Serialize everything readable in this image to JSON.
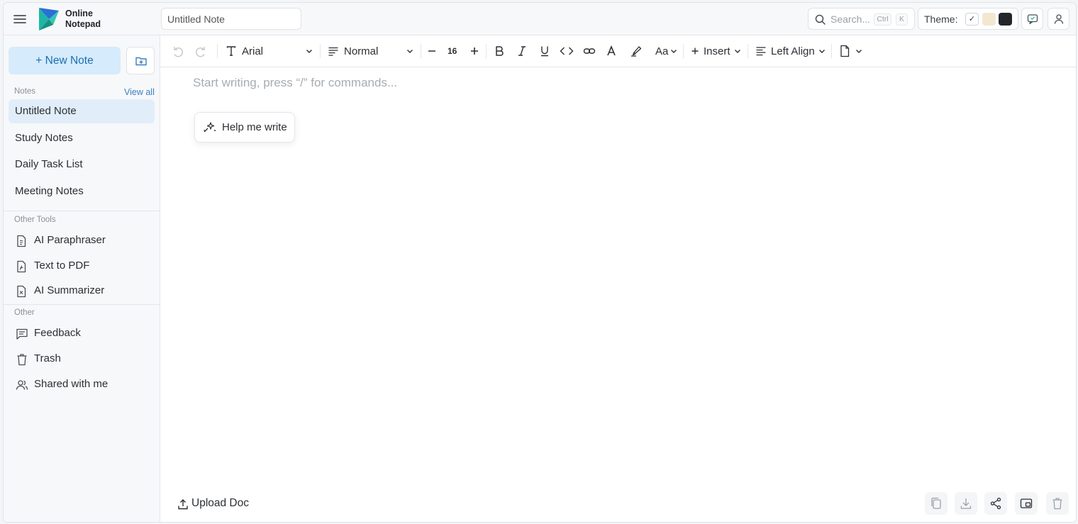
{
  "brand": {
    "line1": "Online",
    "line2": "Notepad"
  },
  "note_title": {
    "value": "Untitled Note",
    "placeholder": "Untitled Note"
  },
  "search": {
    "placeholder": "Search...",
    "shortcut_ctrl": "Ctrl",
    "shortcut_key": "K"
  },
  "theme": {
    "label": "Theme:",
    "selected_mark": "✓",
    "options": [
      "#ffffff",
      "#f3e7d0",
      "#23272b"
    ]
  },
  "sidebar": {
    "new_note": "+  New Note",
    "notes_label": "Notes",
    "view_all": "View all",
    "notes": [
      "Untitled Note",
      "Study Notes",
      "Daily Task List",
      "Meeting Notes"
    ],
    "other_tools_label": "Other Tools",
    "tools": [
      "AI Paraphraser",
      "Text to PDF",
      "AI Summarizer"
    ],
    "other_label": "Other",
    "other": [
      "Feedback",
      "Trash",
      "Shared with me"
    ]
  },
  "toolbar": {
    "font": "Arial",
    "style": "Normal",
    "font_size": "16",
    "case": "Aa",
    "insert": "Insert",
    "align": "Left Align"
  },
  "editor": {
    "placeholder": "Start writing, press “/” for commands...",
    "help_write": "Help me write",
    "upload": "Upload Doc"
  },
  "colors": {
    "accent": "#1a6fb5",
    "accent_bg": "#d6ebfb",
    "active_item_bg": "#e1eefa",
    "logo_teal": "#1fb6a6",
    "logo_blue": "#2a6fd6"
  }
}
